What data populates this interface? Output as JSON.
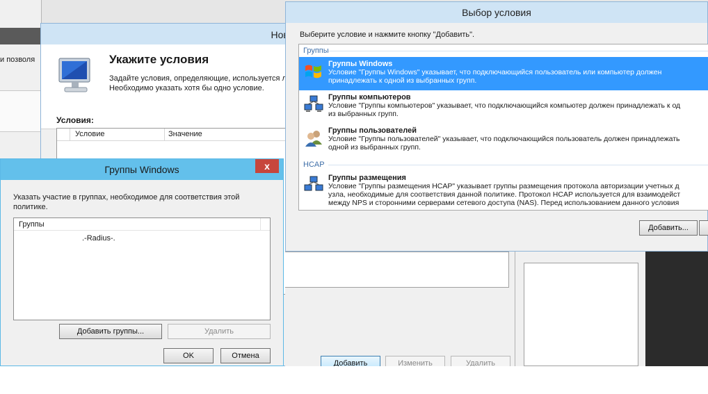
{
  "background": {
    "left_text": "и позволя"
  },
  "policy_window": {
    "title": "Новая поли",
    "heading": "Укажите условия",
    "description": "Задайте условия, определяющие, используется ли\nНеобходимо указать хотя бы одно условие.",
    "conditions_label": "Условия:",
    "columns": [
      "Условие",
      "Значение"
    ],
    "buttons": {
      "add": "Добавить",
      "edit": "Изменить",
      "delete": "Удалить"
    }
  },
  "groups_dialog": {
    "title": "Группы Windows",
    "close_symbol": "x",
    "description": "Указать участие в группах, необходимое для соответствия этой политике.",
    "list_header": "Группы",
    "rows": [
      ".-Radius-."
    ],
    "buttons": {
      "add_groups": "Добавить группы...",
      "remove": "Удалить",
      "ok": "OK",
      "cancel": "Отмена"
    }
  },
  "condition_dialog": {
    "title": "Выбор условия",
    "instruction": "Выберите условие и нажмите кнопку \"Добавить\".",
    "sections": [
      {
        "header": "Группы",
        "items": [
          {
            "name": "Группы Windows",
            "description": "Условие \"Группы Windows\" указывает, что подключающийся пользователь или компьютер должен\nпринадлежать к одной из выбранных групп.",
            "icon": "windows-flag-icon",
            "selected": true
          },
          {
            "name": "Группы компьютеров",
            "description": "Условие \"Группы компьютеров\" указывает, что подключающийся компьютер должен принадлежать к од\nиз выбранных групп.",
            "icon": "computers-group-icon",
            "selected": false
          },
          {
            "name": "Группы пользователей",
            "description": "Условие \"Группы пользователей\" указывает, что подключающийся пользователь должен принадлежать\nодной из выбранных групп.",
            "icon": "users-group-icon",
            "selected": false
          }
        ]
      },
      {
        "header": "HCAP",
        "items": [
          {
            "name": "Группы размещения",
            "description": "Условие \"Группы размещения HCAP\" указывает группы размещения протокола авторизации учетных д\nузла, необходимые для соответствия данной политике. Протокол HCAP используется для взаимодейст\nмежду NPS и сторонними серверами сетевого доступа (NAS). Перед использованием данного условия",
            "icon": "network-group-icon",
            "selected": false
          }
        ]
      }
    ],
    "buttons": {
      "add": "Добавить..."
    }
  },
  "colors": {
    "selection": "#3399ff",
    "dialog_title": "#63c0eb",
    "close": "#c7463c",
    "section_header": "#3e6ea8"
  }
}
